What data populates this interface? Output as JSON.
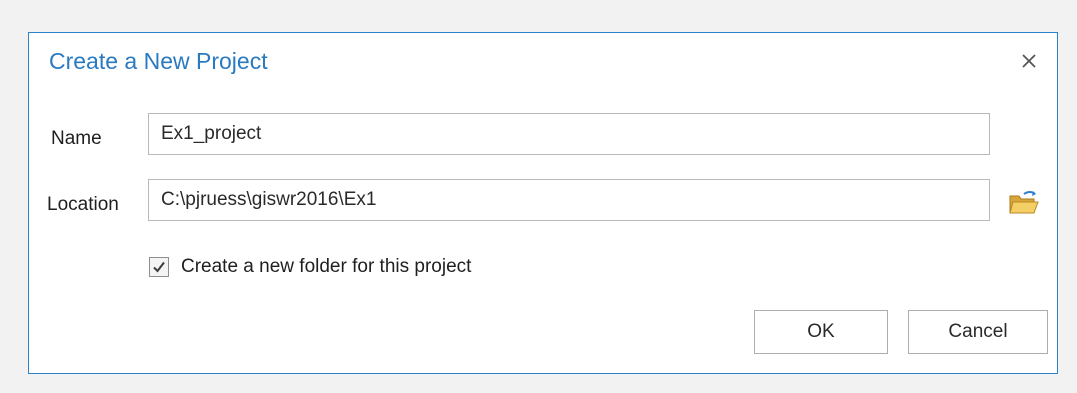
{
  "dialog": {
    "title": "Create a New Project",
    "close_icon": "close-icon"
  },
  "form": {
    "name": {
      "label": "Name",
      "value": "Ex1_project"
    },
    "location": {
      "label": "Location",
      "value": "C:\\pjruess\\giswr2016\\Ex1",
      "browse_icon": "folder-open-icon"
    },
    "create_folder": {
      "label": "Create a new folder for this project",
      "checked": true
    }
  },
  "buttons": {
    "ok_label": "OK",
    "cancel_label": "Cancel"
  },
  "colors": {
    "accent": "#2a7ac0",
    "border": "#2b82c8"
  }
}
